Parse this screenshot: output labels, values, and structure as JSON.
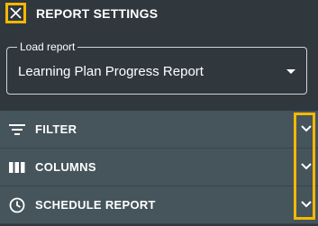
{
  "header": {
    "title": "REPORT SETTINGS",
    "close_icon": "close-icon"
  },
  "load_report": {
    "label": "Load report",
    "selected": "Learning Plan Progress Report"
  },
  "sections": [
    {
      "label": "FILTER",
      "icon": "filter-icon"
    },
    {
      "label": "COLUMNS",
      "icon": "columns-icon"
    },
    {
      "label": "SCHEDULE REPORT",
      "icon": "clock-icon"
    }
  ],
  "colors": {
    "background": "#30383e",
    "row": "#46545b",
    "highlight": "#f5b800"
  }
}
